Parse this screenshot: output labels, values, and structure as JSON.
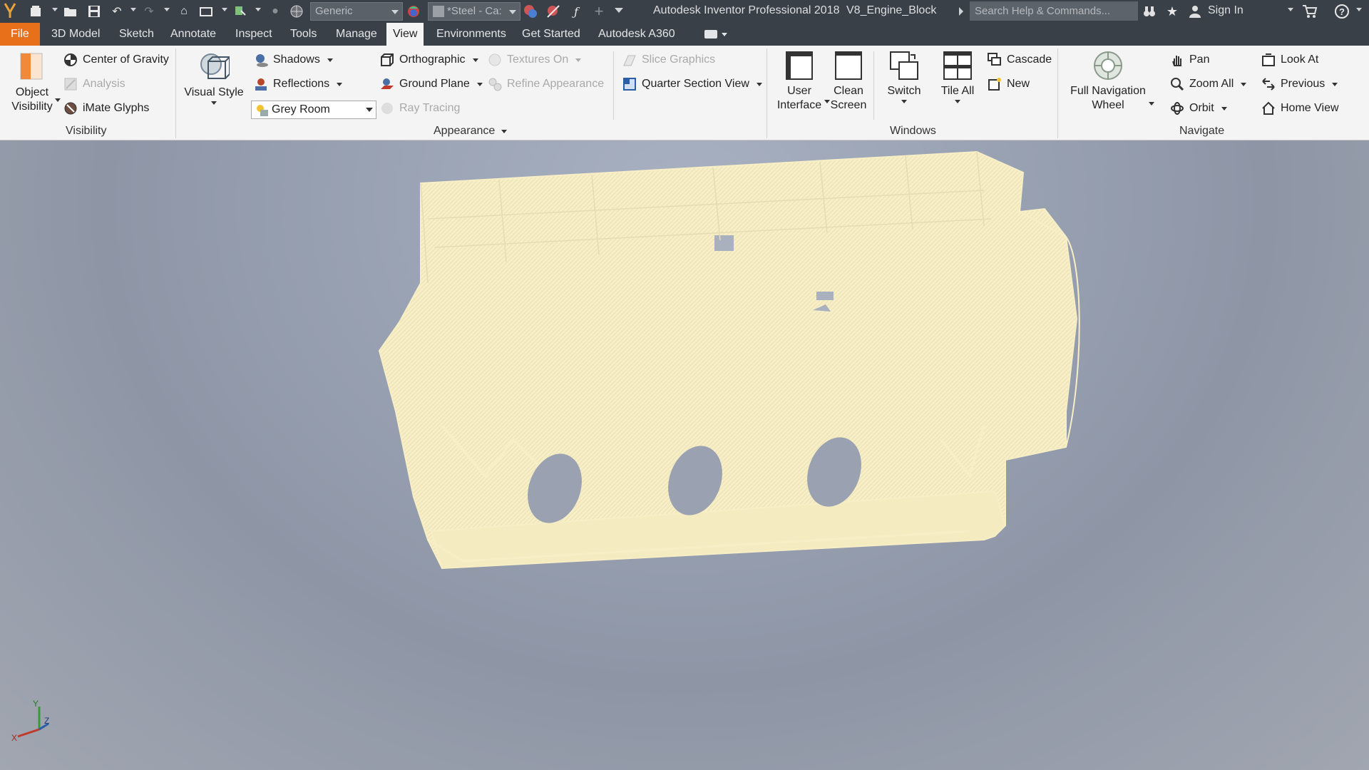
{
  "titlebar": {
    "material_combo": "Generic",
    "appearance_combo": "*Steel - Ca:",
    "app_title": "Autodesk Inventor Professional 2018",
    "doc_title": "V8_Engine_Block",
    "search_placeholder": "Search Help & Commands...",
    "sign_in": "Sign In"
  },
  "menu": {
    "tabs": [
      "File",
      "3D Model",
      "Sketch",
      "Annotate",
      "Inspect",
      "Tools",
      "Manage",
      "View",
      "Environments",
      "Get Started",
      "Autodesk A360"
    ],
    "active": "View"
  },
  "ribbon": {
    "visibility": {
      "title": "Visibility",
      "object_visibility": "Object Visibility",
      "object_visibility_l1": "Object",
      "object_visibility_l2": "Visibility",
      "center_of_gravity": "Center of Gravity",
      "analysis": "Analysis",
      "imate_glyphs": "iMate Glyphs"
    },
    "appearance": {
      "title": "Appearance",
      "visual_style": "Visual Style",
      "shadows": "Shadows",
      "reflections": "Reflections",
      "lighting_style": "Grey Room",
      "orthographic": "Orthographic",
      "ground_plane": "Ground Plane",
      "ray_tracing": "Ray Tracing",
      "textures_on": "Textures On",
      "refine_appearance": "Refine Appearance",
      "slice_graphics": "Slice Graphics",
      "quarter_section_view": "Quarter Section View"
    },
    "windows": {
      "title": "Windows",
      "user_interface_l1": "User",
      "user_interface_l2": "Interface",
      "clean_screen_l1": "Clean",
      "clean_screen_l2": "Screen",
      "switch": "Switch",
      "tile_all": "Tile All",
      "cascade": "Cascade",
      "new": "New"
    },
    "navigate": {
      "title": "Navigate",
      "full_nav_wheel_l1": "Full Navigation",
      "full_nav_wheel_l2": "Wheel",
      "pan": "Pan",
      "zoom_all": "Zoom All",
      "orbit": "Orbit",
      "look_at": "Look At",
      "previous": "Previous",
      "home_view": "Home View"
    }
  },
  "viewport": {
    "model": "V8 engine block (wireframe)",
    "wire_color": "#f7eec6",
    "triad": {
      "x_label": "X",
      "y_label": "Y",
      "z_label": "Z"
    }
  },
  "colors": {
    "file_tab": "#e8701a",
    "titlebar": "#3a4047",
    "ribbon": "#f4f4f4"
  }
}
